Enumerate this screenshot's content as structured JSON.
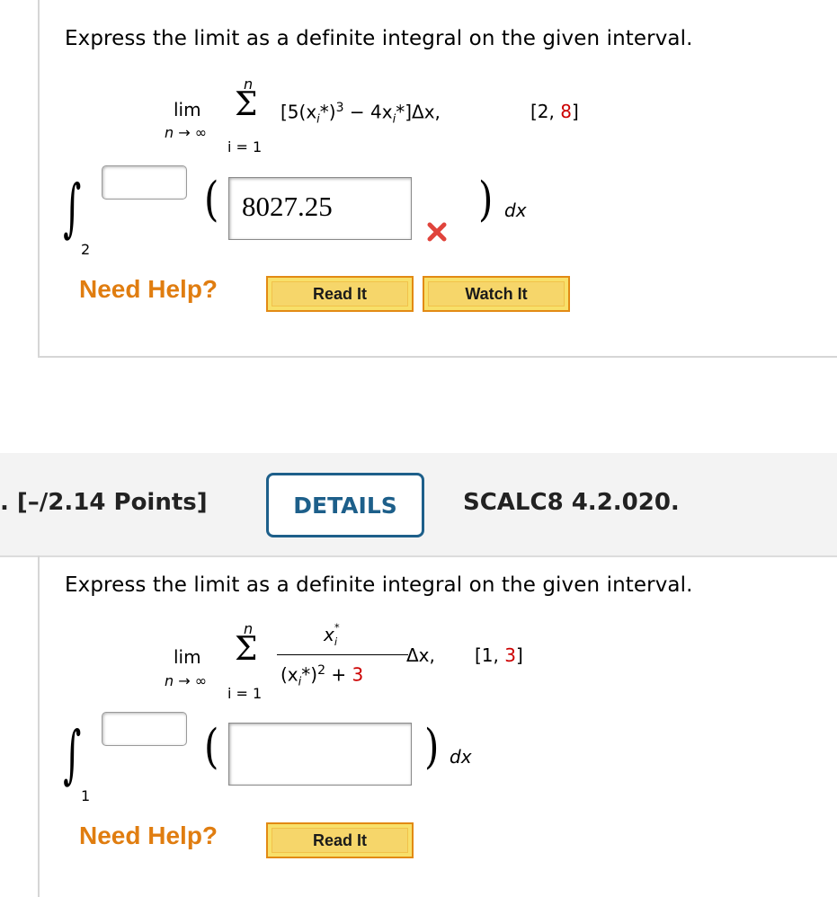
{
  "problem1": {
    "prompt": "Express the limit as a definite integral on the given interval.",
    "limit": {
      "lim": "lim",
      "lim_sub": "n → ∞",
      "sum_top": "n",
      "sum_bottom": "i = 1",
      "expr_open": "[5(x",
      "expr_sub1": "i",
      "expr_mid1": "*)",
      "expr_pow": "3",
      "expr_mid2": " − 4x",
      "expr_sub2": "i",
      "expr_end": "*]Δx,",
      "interval_open": "[2, ",
      "interval_red": "8",
      "interval_close": "]"
    },
    "integral": {
      "upper_value": "",
      "lower": "2",
      "integrand_value": "8027.25",
      "dx": "dx",
      "status_icon": "x-mark-icon"
    },
    "help": {
      "label": "Need Help?",
      "read_it": "Read It",
      "watch_it": "Watch It"
    }
  },
  "header2": {
    "points": ". [–/2.14 Points]",
    "details_button": "DETAILS",
    "code": "SCALC8 4.2.020."
  },
  "problem2": {
    "prompt": "Express the limit as a definite integral on the given interval.",
    "limit": {
      "lim": "lim",
      "lim_sub": "n → ∞",
      "sum_top": "n",
      "sum_bottom": "i = 1",
      "num": "x",
      "num_sub": "i",
      "num_sup": "*",
      "den_open": "(x",
      "den_sub": "i",
      "den_mid": "*)",
      "den_pow": "2",
      "den_plus": " + ",
      "den_red": "3",
      "dx_part": "Δx,",
      "interval_open": "[1, ",
      "interval_red": "3",
      "interval_close": "]"
    },
    "integral": {
      "upper_value": "",
      "lower": "1",
      "integrand_value": "",
      "dx": "dx"
    },
    "help": {
      "label": "Need Help?",
      "read_it": "Read It"
    }
  },
  "colors": {
    "accent_red": "#cc0000",
    "help_orange": "#e07d10",
    "details_blue": "#1d5f8a",
    "button_fill": "#f6d66a"
  }
}
